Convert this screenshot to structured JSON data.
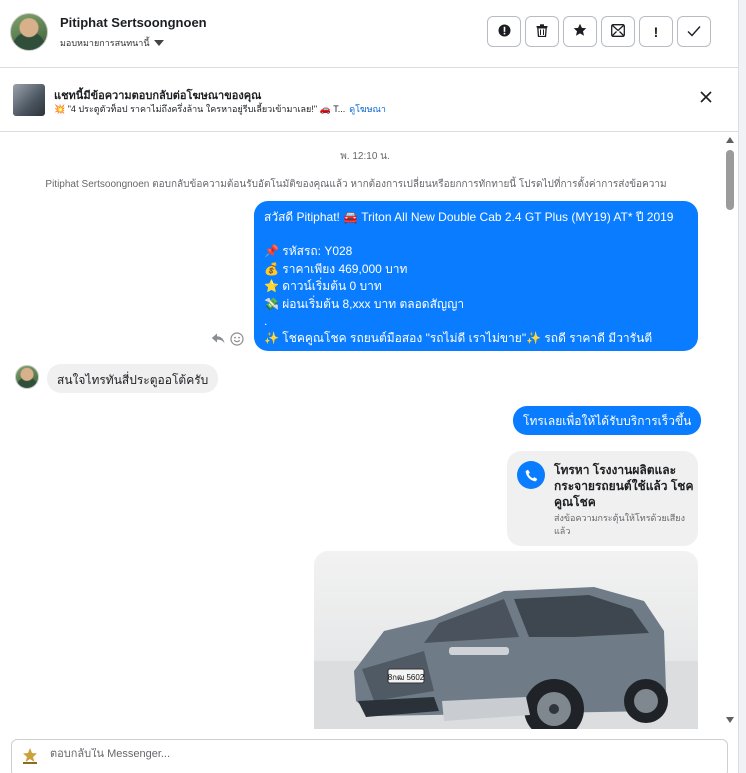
{
  "header": {
    "contact_name": "Pitiphat Sertsoongnoen",
    "assign_label": "มอบหมายการสนทนานี้",
    "actions": [
      {
        "icon": "alert-circle-icon",
        "glyph": "❗"
      },
      {
        "icon": "trash-icon",
        "glyph": "🗑"
      },
      {
        "icon": "star-icon",
        "glyph": "★"
      },
      {
        "icon": "archive-icon",
        "glyph": "⊠"
      },
      {
        "icon": "exclamation-icon",
        "glyph": "!"
      },
      {
        "icon": "checkmark-icon",
        "glyph": "✓"
      }
    ]
  },
  "banner": {
    "title": "แชทนี้มีข้อความตอบกลับต่อโฆษณาของคุณ",
    "preview": "💥 \"4 ประตูตัวท็อป ราคาไม่ถึงครึ่งล้าน ใครหาอยู่รีบเลี้ยวเข้ามาเลย!\" 🚗 T...",
    "link": "ดูโฆษณา",
    "close_icon": "×"
  },
  "thread": {
    "timestamp": "พ. 12:10 น.",
    "system_note": "Pitiphat Sertsoongnoen ตอบกลับข้อความต้อนรับอัตโนมัติของคุณแล้ว หากต้องการเปลี่ยนหรือยกการทักทายนี้ โปรดไปที่การตั้งค่าการส่งข้อความ",
    "auto_reply": {
      "l1": "สวัสดี Pitiphat! 🚘 Triton All New Double Cab 2.4 GT Plus (MY19) AT* ปี 2019",
      "l2": "📌 รหัสรถ: Y028",
      "l3": "💰 ราคาเพียง 469,000 บาท",
      "l4": "⭐ ดาวน์เริ่มต้น 0 บาท",
      "l5": "💸 ผ่อนเริ่มต้น 8,xxx บาท ตลอดสัญญา",
      "l6": ".",
      "l7": "✨ โชคคูณโชค รถยนต์มือสอง \"รถไม่ดี เราไม่ขาย\"✨ รถดี ราคาดี มีวารันตี"
    },
    "incoming": "สนใจไทรทันสี่ประตูออโต้ครับ",
    "outgoing_call": "โทรเลยเพื่อให้ได้รับบริการเร็วขึ้น",
    "call_card": {
      "title": "โทรหา โรงงานผลิตและกระจายรถยนต์ใช้แล้ว โชคคูณโชค",
      "subtitle": "ส่งข้อความกระตุ้นให้โทรด้วยเสียงแล้ว"
    },
    "plate": "8กฒ 5602"
  },
  "composer": {
    "placeholder": "ตอบกลับใน Messenger..."
  }
}
